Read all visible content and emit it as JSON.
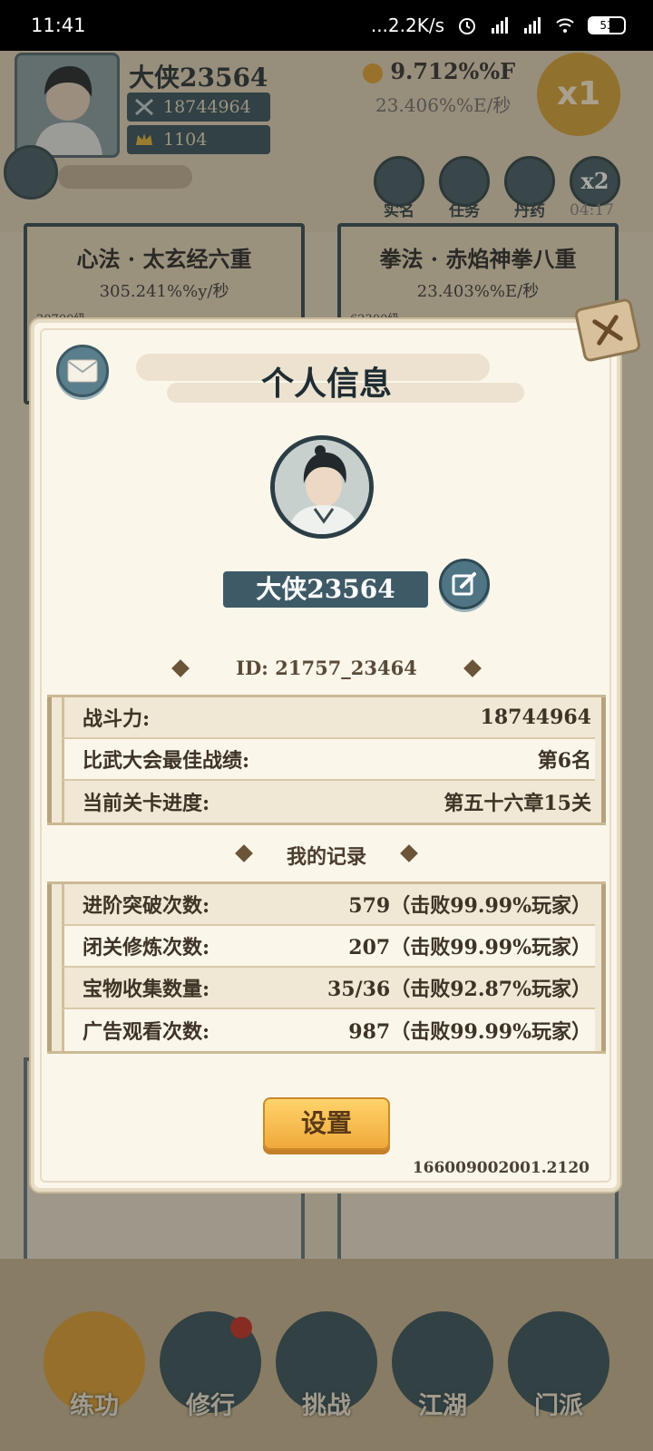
{
  "status_bar": {
    "time": "11:41",
    "network_speed": "...2.2K/s",
    "battery": "53"
  },
  "game": {
    "player_name": "大侠23564",
    "combat_power": "18744964",
    "gold": "1104",
    "currency": "9.712%%F",
    "currency_rate": "23.406%%E/秒",
    "multiplier": "x1",
    "menu": [
      {
        "label": "实名"
      },
      {
        "label": "任务"
      },
      {
        "label": "丹药"
      },
      {
        "label": "x2"
      }
    ],
    "timer": "04:17",
    "skills": [
      {
        "title": "心法 · 太玄经六重",
        "rate": "305.241%%y/秒",
        "level": "30700级"
      },
      {
        "title": "拳法 · 赤焰神拳八重",
        "rate": "23.403%%E/秒",
        "level": "62300级"
      }
    ],
    "nav": [
      {
        "label": "练功"
      },
      {
        "label": "修行"
      },
      {
        "label": "挑战"
      },
      {
        "label": "江湖"
      },
      {
        "label": "门派"
      }
    ]
  },
  "modal": {
    "title": "个人信息",
    "name": "大侠23564",
    "id_text": "ID:  21757_23464",
    "stats": [
      {
        "label": "战斗力:",
        "value": "18744964"
      },
      {
        "label": "比武大会最佳战绩:",
        "value": "第6名"
      },
      {
        "label": "当前关卡进度:",
        "value": "第五十六章15关"
      }
    ],
    "records_title": "我的记录",
    "records": [
      {
        "label": "进阶突破次数:",
        "value": "579（击败99.99%玩家）"
      },
      {
        "label": "闭关修炼次数:",
        "value": "207（击败99.99%玩家）"
      },
      {
        "label": "宝物收集数量:",
        "value": "35/36（击败92.87%玩家）"
      },
      {
        "label": "广告观看次数:",
        "value": "987（击败99.99%玩家）"
      }
    ],
    "settings_label": "设置",
    "version": "166009002001.2120"
  },
  "colors": {
    "accent_dark": "#3e5a66",
    "button_gold": "#f0a93a",
    "panel_bg": "#fbf6ea"
  }
}
